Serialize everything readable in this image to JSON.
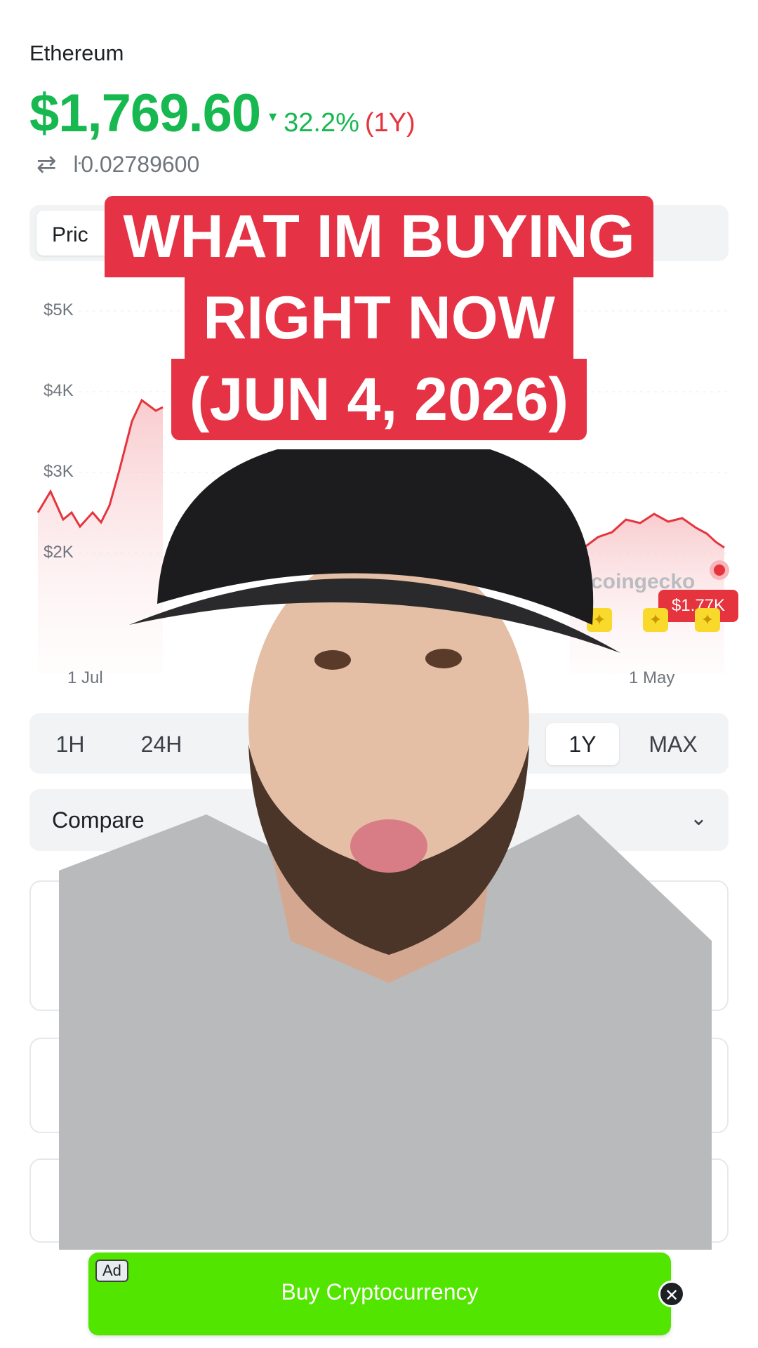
{
  "coin": {
    "name": "Ethereum",
    "price": "$1,769.60",
    "delta_arrow": "▾",
    "delta": "32.2%",
    "period": "(1Y)",
    "btc_icon": "swap-arrows-icon",
    "btc_price": "ŀ0.02789600"
  },
  "tabs": {
    "price_label": "Pric"
  },
  "chart_data": {
    "type": "area",
    "y_tick_labels": [
      "$5K",
      "$4K",
      "$3K",
      "$2K"
    ],
    "x_tick_labels": [
      "1 Jul",
      "1 May"
    ],
    "series": [
      {
        "values_visible_left": [
          2250,
          2460,
          2150,
          2280,
          2120,
          2350,
          2420,
          3100,
          3500,
          3780,
          3920,
          3770,
          3870
        ],
        "values_visible_right": [
          2000,
          1950,
          2100,
          2200,
          2230,
          2420,
          2330,
          2480,
          2350,
          2400,
          2250,
          2200,
          2000,
          1890,
          1770
        ]
      }
    ],
    "current_value_label": "$1.77K",
    "watermark": "coingecko",
    "line_color": "#e5343d"
  },
  "ranges": {
    "items": [
      "1H",
      "24H",
      "1Y",
      "MAX"
    ],
    "active": "1Y"
  },
  "compare": {
    "label": "Compare",
    "chevron_icon": "chevron-down-icon"
  },
  "overlay": {
    "headline_lines": [
      "WHAT IM BUYING",
      "RIGHT NOW",
      "(JUN 4, 2026)"
    ],
    "headline_color": "#e53245"
  },
  "ad": {
    "tag": "Ad",
    "label": "Buy Cryptocurrency",
    "close_icon": "close-icon",
    "color": "#52e500"
  }
}
